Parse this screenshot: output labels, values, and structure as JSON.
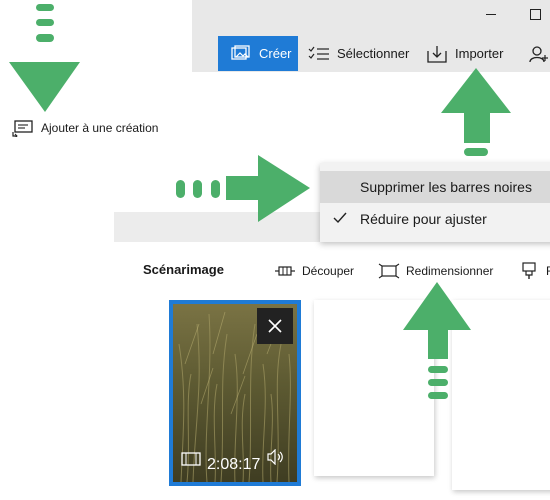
{
  "toolbar": {
    "create_label": "Créer",
    "select_label": "Sélectionner",
    "import_label": "Importer"
  },
  "add_to_creation": {
    "label": "Ajouter à une création"
  },
  "menu": {
    "items": [
      {
        "label": "Supprimer les barres noires",
        "checked": false,
        "highlighted": true
      },
      {
        "label": "Réduire pour ajuster",
        "checked": true,
        "highlighted": false
      }
    ]
  },
  "storyboard": {
    "title": "Scénarimage",
    "cut_label": "Découper",
    "resize_label": "Redimensionner",
    "filter_label": "F"
  },
  "clip": {
    "duration": "2:08:17"
  },
  "colors": {
    "accent": "#1f7bd6",
    "arrow": "#4caf6a"
  },
  "icons": [
    "create-icon",
    "select-list-icon",
    "import-icon",
    "add-user-icon",
    "add-creation-icon",
    "cut-icon",
    "resize-icon",
    "filter-icon",
    "close-icon",
    "film-icon",
    "audio-icon",
    "check-icon"
  ]
}
